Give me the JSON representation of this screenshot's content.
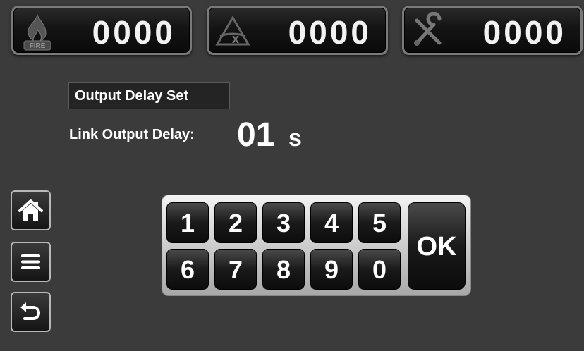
{
  "counters": [
    {
      "icon": "fire-icon",
      "icon_text": "FIRE",
      "value": "0000"
    },
    {
      "icon": "fault-icon",
      "icon_text": "x",
      "value": "0000"
    },
    {
      "icon": "tools-icon",
      "value": "0000"
    }
  ],
  "page": {
    "title": "Output Delay Set",
    "link_label": "Link Output Delay:",
    "link_value": "01",
    "link_unit": "s"
  },
  "keypad": {
    "row1": [
      "1",
      "2",
      "3",
      "4",
      "5"
    ],
    "row2": [
      "6",
      "7",
      "8",
      "9",
      "0"
    ],
    "ok": "OK"
  },
  "sidebar": [
    "home-icon",
    "menu-icon",
    "back-icon"
  ]
}
